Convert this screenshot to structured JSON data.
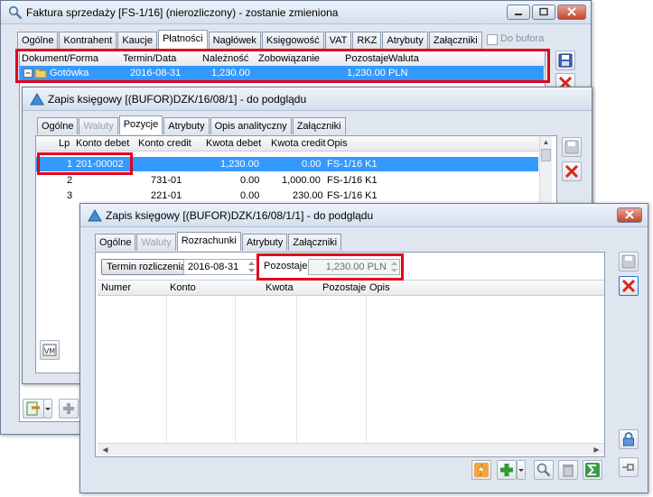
{
  "win1": {
    "title": "Faktura sprzedaży [FS-1/16] (nierozliczony) - zostanie zmieniona",
    "tabs": [
      "Ogólne",
      "Kontrahent",
      "Kaucje",
      "Płatności",
      "Nagłówek",
      "Księgowość",
      "VAT",
      "RKZ",
      "Atrybuty",
      "Załączniki"
    ],
    "do_bufora": "Do bufora",
    "columns": [
      "Dokument/Forma",
      "Termin/Data",
      "Należność",
      "Zobowiązanie",
      "Pozostaje",
      "Waluta"
    ],
    "row": {
      "forma": "Gotówka",
      "data": "2016-08-31",
      "naleznosc": "1,230.00",
      "zobowiazanie": "",
      "pozostaje": "1,230.00",
      "waluta": "PLN"
    },
    "colors": {
      "selection": "#3399ff",
      "highlight": "#e3001b"
    }
  },
  "win2": {
    "title": "Zapis księgowy [(BUFOR)DZK/16/08/1] - do podglądu",
    "tabs": [
      "Ogólne",
      "Waluty",
      "Pozycje",
      "Atrybuty",
      "Opis analityczny",
      "Załączniki"
    ],
    "columns": [
      "Lp",
      "Konto debet",
      "Konto credit",
      "Kwota debet",
      "Kwota credit",
      "Opis"
    ],
    "rows": [
      {
        "lp": "1",
        "debet": "201-00002",
        "credit": "",
        "kwota_debet": "1,230.00",
        "kwota_credit": "0.00",
        "opis": "FS-1/16 K1"
      },
      {
        "lp": "2",
        "debet": "",
        "credit": "731-01",
        "kwota_debet": "0.00",
        "kwota_credit": "1,000.00",
        "opis": "FS-1/16 K1"
      },
      {
        "lp": "3",
        "debet": "",
        "credit": "221-01",
        "kwota_debet": "0.00",
        "kwota_credit": "230.00",
        "opis": "FS-1/16 K1"
      }
    ]
  },
  "win3": {
    "title": "Zapis księgowy [(BUFOR)DZK/16/08/1/1] - do podglądu",
    "tabs": [
      "Ogólne",
      "Waluty",
      "Rozrachunki",
      "Atrybuty",
      "Załączniki"
    ],
    "termin_button": "Termin rozliczenia",
    "termin_value": "2016-08-31",
    "pozostaje_label": "Pozostaje:",
    "pozostaje_value": "1,230.00 PLN",
    "columns": [
      "Numer",
      "Konto",
      "Kwota",
      "Pozostaje",
      "Opis"
    ]
  }
}
